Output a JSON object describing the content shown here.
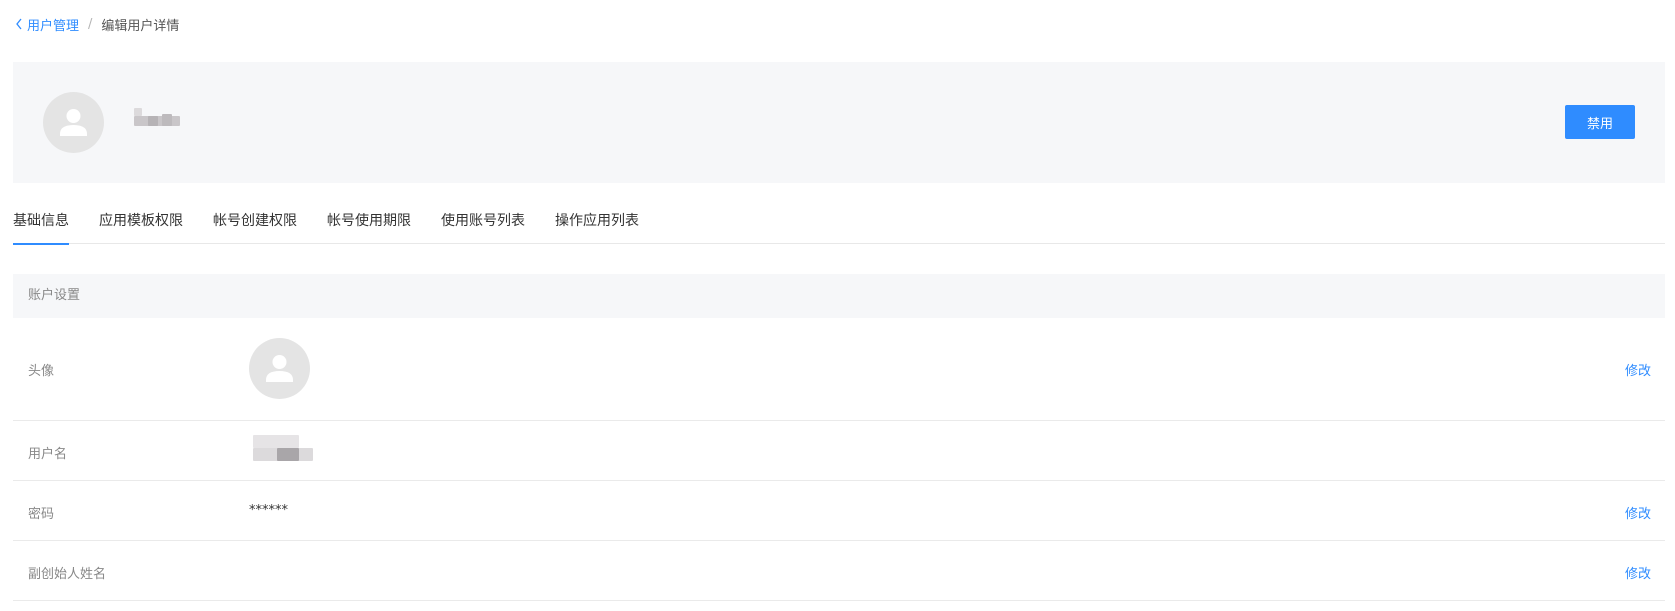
{
  "breadcrumb": {
    "back_label": "用户管理",
    "separator": "/",
    "current": "编辑用户详情"
  },
  "header": {
    "disable_button": "禁用"
  },
  "tabs": [
    {
      "label": "基础信息",
      "active": true
    },
    {
      "label": "应用模板权限",
      "active": false
    },
    {
      "label": "帐号创建权限",
      "active": false
    },
    {
      "label": "帐号使用期限",
      "active": false
    },
    {
      "label": "使用账号列表",
      "active": false
    },
    {
      "label": "操作应用列表",
      "active": false
    }
  ],
  "account_settings": {
    "title": "账户设置",
    "rows": {
      "avatar": {
        "label": "头像",
        "edit": "修改"
      },
      "username": {
        "label": "用户名"
      },
      "password": {
        "label": "密码",
        "value": "******",
        "edit": "修改"
      },
      "cofounder": {
        "label": "副创始人姓名",
        "edit": "修改"
      }
    }
  },
  "colors": {
    "accent": "#2f8cff",
    "panel_bg": "#f6f7f9",
    "avatar_bg": "#e4e4e4"
  },
  "icons": [
    "chevron-left-icon",
    "user-avatar-icon"
  ]
}
